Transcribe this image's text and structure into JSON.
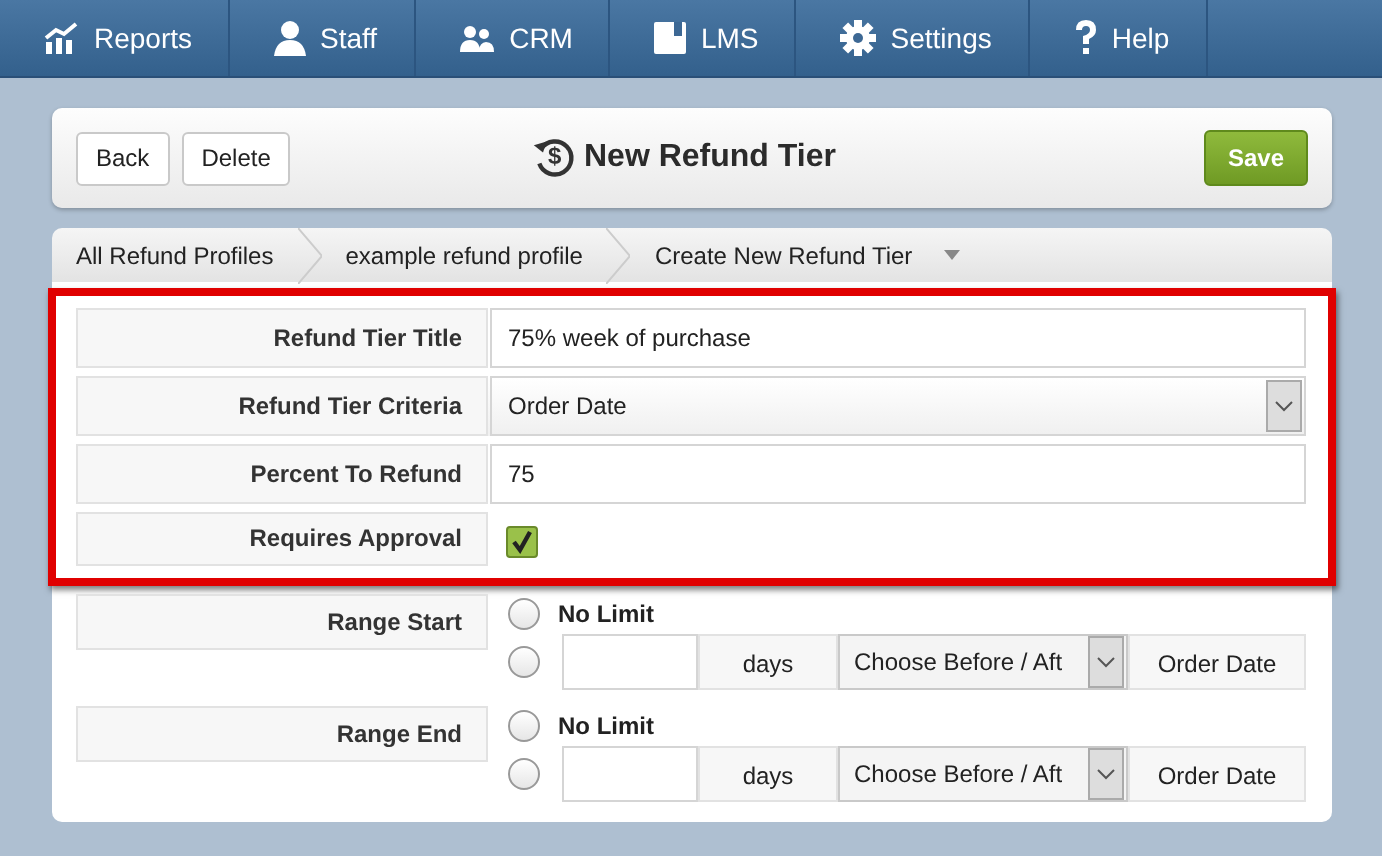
{
  "nav": [
    {
      "label": "Reports"
    },
    {
      "label": "Staff"
    },
    {
      "label": "CRM"
    },
    {
      "label": "LMS"
    },
    {
      "label": "Settings"
    },
    {
      "label": "Help"
    }
  ],
  "toolbar": {
    "buttons": [
      "Back",
      "Delete"
    ],
    "title": "New Refund Tier",
    "title_symbol": "$",
    "save": "Save"
  },
  "breadcrumbs": [
    {
      "label": "All Refund Profiles"
    },
    {
      "label": "example refund profile"
    },
    {
      "label": "Create New Refund Tier"
    }
  ],
  "sections": [
    {
      "highlighted": true,
      "fields": [
        {
          "kind": "text",
          "label": "Refund Tier Title",
          "value": "75% week of purchase"
        },
        {
          "kind": "select",
          "label": "Refund Tier Criteria",
          "value": "Order Date"
        },
        {
          "kind": "text",
          "label": "Percent To Refund",
          "value": "75"
        },
        {
          "kind": "checkbox",
          "label": "Requires Approval",
          "checked": true
        }
      ]
    },
    {
      "highlighted": false,
      "fields": [
        {
          "kind": "range",
          "label": "Range Start",
          "no_limit": {
            "label": "No Limit",
            "selected": false
          },
          "relative": {
            "selected": false,
            "unit": "days",
            "direction": "Choose Before / Aft",
            "anchor": "Order Date"
          }
        },
        {
          "kind": "range",
          "label": "Range End",
          "no_limit": {
            "label": "No Limit",
            "selected": false
          },
          "relative": {
            "selected": false,
            "unit": "days",
            "direction": "Choose Before / Aft",
            "anchor": "Order Date"
          }
        }
      ]
    }
  ]
}
